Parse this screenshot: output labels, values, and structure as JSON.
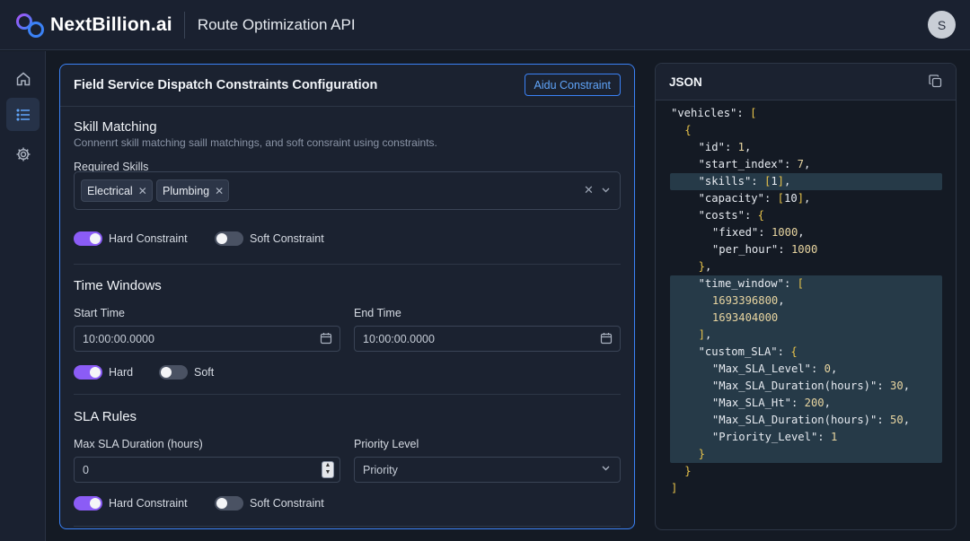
{
  "brand": {
    "name": "NextBillion.ai"
  },
  "header": {
    "title": "Route Optimization API",
    "avatar_initial": "S"
  },
  "sidebar": {
    "items": [
      {
        "name": "home-icon",
        "active": false
      },
      {
        "name": "list-icon",
        "active": true
      },
      {
        "name": "gear-icon",
        "active": false
      }
    ]
  },
  "config": {
    "title": "Field Service Dispatch Constraints Configuration",
    "add_button": "Aidu Constraint",
    "skill_matching": {
      "title": "Skill Matching",
      "description": "Connenrt skill matching saill matchings, and soft consraint using constraints.",
      "required_label": "Required Skills",
      "tags": [
        "Electrical",
        "Plumbing"
      ],
      "hard_label": "Hard Constraint",
      "hard_on": true,
      "soft_label": "Soft Constraint",
      "soft_on": false
    },
    "time_windows": {
      "title": "Time Windows",
      "start_label": "Start Time",
      "start_value": "10:00:00.0000",
      "end_label": "End Time",
      "end_value": "10:00:00.0000",
      "hard_label": "Hard",
      "hard_on": true,
      "soft_label": "Soft",
      "soft_on": false
    },
    "sla_rules": {
      "title": "SLA Rules",
      "duration_label": "Max SLA Duration (hours)",
      "duration_value": "0",
      "priority_label": "Priority Level",
      "priority_value": "Priority",
      "hard_label": "Hard Constraint",
      "hard_on": true,
      "soft_label": "Soft Constraint",
      "soft_on": false
    }
  },
  "json_panel": {
    "title": "JSON",
    "lines": [
      "\"vehicles\": [",
      "{",
      "\"id\": 1,",
      "\"start_index\": 7,",
      "\"skills\": [1],",
      "\"capacity\": [10],",
      "\"costs\": {",
      "\"fixed\": 1000,",
      "\"per_hour\": 1000",
      "},",
      "\"time_window\": [",
      "1693396800,",
      "1693404000",
      "],",
      "\"custom_SLA\": {",
      "\"Max_SLA_Level\": 0,",
      "\"Max_SLA_Duration(hours)\": 30,",
      "\"Max_SLA_Ht\": 200,",
      "\"Max_SLA_Duration(hours)\": 50,",
      "\"Priority_Level\": 1",
      "}",
      "}",
      "]"
    ]
  },
  "colors": {
    "accent": "#3b82f6",
    "toggle_on": "#8b5cf6",
    "background": "#141a24"
  }
}
